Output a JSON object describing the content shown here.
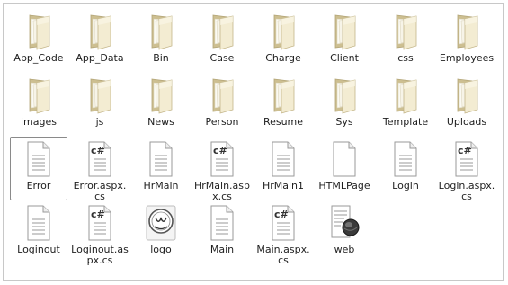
{
  "items": [
    {
      "label": "App_Code",
      "icon": "folder-icon"
    },
    {
      "label": "App_Data",
      "icon": "folder-icon"
    },
    {
      "label": "Bin",
      "icon": "folder-icon"
    },
    {
      "label": "Case",
      "icon": "folder-icon"
    },
    {
      "label": "Charge",
      "icon": "folder-icon"
    },
    {
      "label": "Client",
      "icon": "folder-icon"
    },
    {
      "label": "css",
      "icon": "folder-icon"
    },
    {
      "label": "Employees",
      "icon": "folder-icon"
    },
    {
      "label": "images",
      "icon": "folder-icon"
    },
    {
      "label": "js",
      "icon": "folder-icon"
    },
    {
      "label": "News",
      "icon": "folder-icon"
    },
    {
      "label": "Person",
      "icon": "folder-icon"
    },
    {
      "label": "Resume",
      "icon": "folder-icon"
    },
    {
      "label": "Sys",
      "icon": "folder-icon"
    },
    {
      "label": "Template",
      "icon": "folder-icon"
    },
    {
      "label": "Uploads",
      "icon": "folder-icon"
    },
    {
      "label": "Error",
      "icon": "document-icon",
      "selected": true
    },
    {
      "label": "Error.aspx.cs",
      "icon": "csharp-file-icon"
    },
    {
      "label": "HrMain",
      "icon": "document-icon"
    },
    {
      "label": "HrMain.aspx.cs",
      "icon": "csharp-file-icon"
    },
    {
      "label": "HrMain1",
      "icon": "document-icon"
    },
    {
      "label": "HTMLPage",
      "icon": "blank-file-icon"
    },
    {
      "label": "Login",
      "icon": "document-icon"
    },
    {
      "label": "Login.aspx.cs",
      "icon": "csharp-file-icon"
    },
    {
      "label": "Loginout",
      "icon": "document-icon"
    },
    {
      "label": "Loginout.aspx.cs",
      "icon": "csharp-file-icon"
    },
    {
      "label": "logo",
      "icon": "logo-image-icon"
    },
    {
      "label": "Main",
      "icon": "document-icon"
    },
    {
      "label": "Main.aspx.cs",
      "icon": "csharp-file-icon"
    },
    {
      "label": "web",
      "icon": "web-config-icon"
    }
  ],
  "colors": {
    "folder_light": "#f3ecd2",
    "folder_dark": "#cdbf91",
    "file_border": "#9a9a9a",
    "selection_border": "#8a8a8a"
  }
}
